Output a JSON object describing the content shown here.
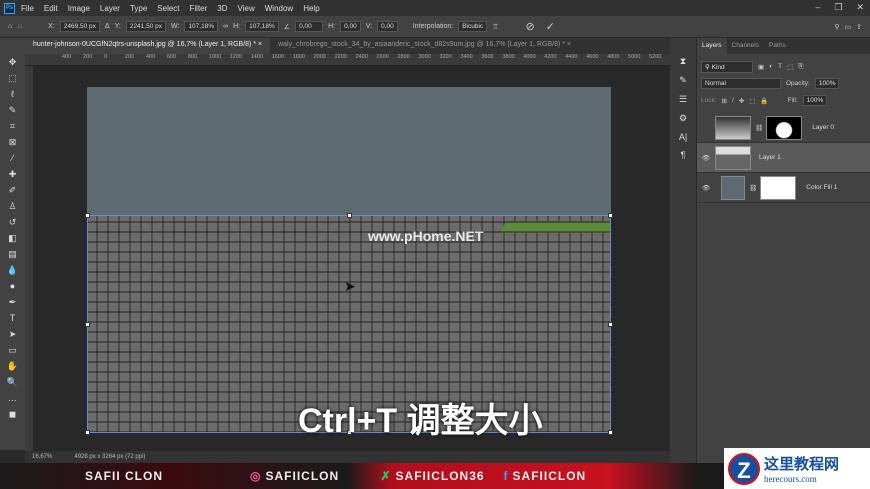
{
  "menu": [
    "File",
    "Edit",
    "Image",
    "Layer",
    "Type",
    "Select",
    "Filter",
    "3D",
    "View",
    "Window",
    "Help"
  ],
  "options": {
    "x": "2469,50 px",
    "y": "2241,50 px",
    "w": "107,18%",
    "h": "107,18%",
    "angle": "0,00",
    "hskew": "0,00",
    "vskew": "0,00",
    "interp_label": "Interpolation:",
    "interp": "Bicubic"
  },
  "tabs": [
    "hunter-johnson-0UCGfN2qtrs-unsplash.jpg @ 16,7% (Layer 1, RGB/8) *",
    "waly_chrobrego_stock_34_by_asiaanderic_stock_d82s9um.jpg @ 16,7% (Layer 1, RGB/8) *"
  ],
  "ruler": [
    "400",
    "200",
    "0",
    "200",
    "400",
    "600",
    "800",
    "1000",
    "1200",
    "1400",
    "1600",
    "1800",
    "2000",
    "2200",
    "2400",
    "2600",
    "2800",
    "3000",
    "3200",
    "3400",
    "3600",
    "3800",
    "4000",
    "4200",
    "4400",
    "4600",
    "4800",
    "5000",
    "5200"
  ],
  "canvas": {
    "watermark": "www.pHome.NET",
    "subtitle": "Ctrl+T 调整大小"
  },
  "status": {
    "zoom": "16,67%",
    "size": "4928 px x 3264 px (72 ppi)"
  },
  "panel": {
    "tabs": [
      "Layers",
      "Channels",
      "Paths"
    ],
    "kind": "Kind",
    "blend": "Normal",
    "opacity_label": "Opacity:",
    "opacity": "100%",
    "lock_label": "Lock:",
    "fill_label": "Fill:",
    "fill": "100%",
    "layers": [
      {
        "name": "Layer 0"
      },
      {
        "name": "Layer 1"
      },
      {
        "name": "Color Fill 1"
      }
    ]
  },
  "footer": {
    "name": "SAFII CLON",
    "instagram": "SAFIICLON",
    "deviantart": "SAFIICLON36",
    "facebook": "SAFIICLON"
  },
  "logo": {
    "title": "这里教程网",
    "url": "herecours.com"
  }
}
